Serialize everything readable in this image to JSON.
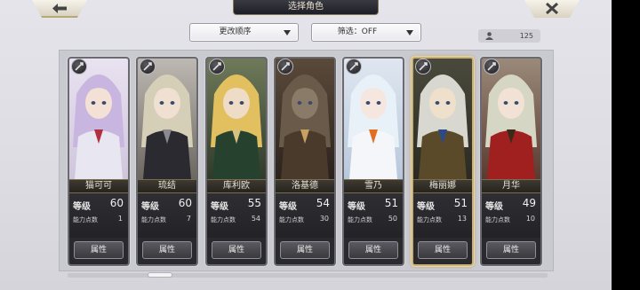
{
  "header": {
    "title": "选择角色"
  },
  "toolbar": {
    "sort_label": "更改顺序",
    "filter_label": "筛选：OFF",
    "roster_count": "125"
  },
  "cards": [
    {
      "name": "猫可可",
      "level_label": "等级",
      "level": "60",
      "points_label": "能力点数",
      "points": "1",
      "attr_label": "属性",
      "selected": false
    },
    {
      "name": "琉结",
      "level_label": "等级",
      "level": "60",
      "points_label": "能力点数",
      "points": "7",
      "attr_label": "属性",
      "selected": false
    },
    {
      "name": "库利欧",
      "level_label": "等级",
      "level": "55",
      "points_label": "能力点数",
      "points": "54",
      "attr_label": "属性",
      "selected": false
    },
    {
      "name": "洛基德",
      "level_label": "等级",
      "level": "54",
      "points_label": "能力点数",
      "points": "30",
      "attr_label": "属性",
      "selected": false
    },
    {
      "name": "雪乃",
      "level_label": "等级",
      "level": "51",
      "points_label": "能力点数",
      "points": "50",
      "attr_label": "属性",
      "selected": false
    },
    {
      "name": "梅丽娜",
      "level_label": "等级",
      "level": "51",
      "points_label": "能力点数",
      "points": "13",
      "attr_label": "属性",
      "selected": true
    },
    {
      "name": "月华",
      "level_label": "等级",
      "level": "49",
      "points_label": "能力点数",
      "points": "10",
      "attr_label": "属性",
      "selected": false
    }
  ]
}
